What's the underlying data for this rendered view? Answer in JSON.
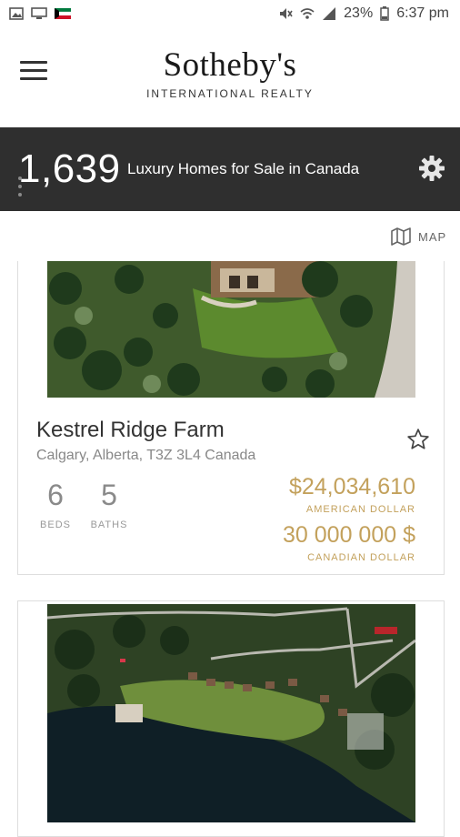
{
  "status_bar": {
    "battery": "23%",
    "time": "6:37 pm"
  },
  "header": {
    "brand": "Sotheby's",
    "brand_sub": "INTERNATIONAL REALTY"
  },
  "listing_summary": {
    "count": "1,639",
    "label": "Luxury Homes for Sale in Canada"
  },
  "view_toggle": {
    "label": "MAP"
  },
  "listings": [
    {
      "title": "Kestrel Ridge Farm",
      "address": "Calgary, Alberta, T3Z 3L4 Canada",
      "beds": "6",
      "beds_label": "BEDS",
      "baths": "5",
      "baths_label": "BATHS",
      "price_usd": "$24,034,610",
      "price_usd_label": "AMERICAN DOLLAR",
      "price_cad": "30 000 000 $",
      "price_cad_label": "CANADIAN DOLLAR"
    }
  ],
  "colors": {
    "accent_gold": "#c3a15c",
    "count_bar": "#2f2f2f"
  }
}
